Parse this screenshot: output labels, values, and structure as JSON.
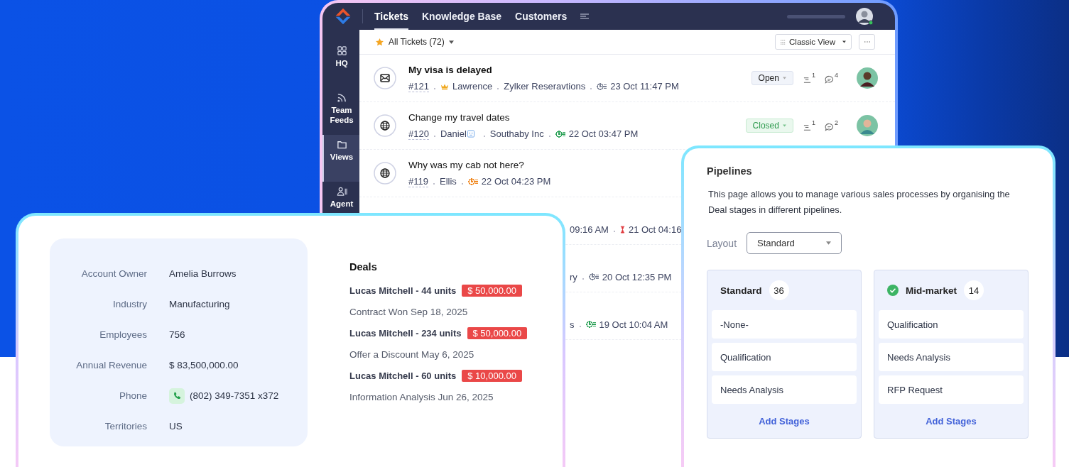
{
  "tickets_window": {
    "nav_tabs": [
      {
        "label": "Tickets",
        "selected": true
      },
      {
        "label": "Knowledge Base",
        "selected": false
      },
      {
        "label": "Customers",
        "selected": false
      }
    ],
    "sidebar": [
      {
        "label": "HQ",
        "selected": false
      },
      {
        "label": "Team Feeds",
        "selected": false
      },
      {
        "label": "Views",
        "selected": true
      },
      {
        "label": "Agent",
        "selected": false
      }
    ],
    "view_filter": "All Tickets (72)",
    "view_mode": "Classic View",
    "tickets": [
      {
        "kind": "email",
        "title": "My visa is delayed",
        "unread": true,
        "meta": [
          {
            "kind": "id",
            "text": "#121"
          },
          {
            "kind": "vip-contact",
            "text": "Lawrence"
          },
          {
            "kind": "account",
            "text": "Zylker Reseravtions"
          },
          {
            "kind": "due",
            "text": "23 Oct 11:47 PM",
            "color": "#7a8194"
          }
        ],
        "status": {
          "label": "Open",
          "kind": "open"
        },
        "tasks": "1",
        "comments": "4"
      },
      {
        "kind": "web",
        "title": "Change my travel dates",
        "unread": false,
        "meta": [
          {
            "kind": "id",
            "text": "#120"
          },
          {
            "kind": "card-contact",
            "text": "Daniel"
          },
          {
            "kind": "account",
            "text": "Southaby Inc"
          },
          {
            "kind": "due",
            "text": "22 Oct 03:47 PM",
            "color": "#2fa35a"
          }
        ],
        "status": {
          "label": "Closed",
          "kind": "closed"
        },
        "tasks": "1",
        "comments": "2"
      },
      {
        "kind": "web",
        "title": "Why was my cab not here?",
        "unread": false,
        "meta": [
          {
            "kind": "id",
            "text": "#119"
          },
          {
            "kind": "contact",
            "text": "Ellis"
          },
          {
            "kind": "due",
            "text": "22 Oct 04:23 PM",
            "color": "#f08a24"
          }
        ]
      },
      {
        "kind": "partial",
        "meta": [
          {
            "kind": "time",
            "text": "09:16 AM"
          },
          {
            "kind": "overdue",
            "text": "21 Oct 04:16"
          }
        ]
      },
      {
        "kind": "partial",
        "meta": [
          {
            "kind": "account",
            "text": "ry"
          },
          {
            "kind": "due",
            "text": "20 Oct 12:35 PM",
            "color": "#7a8194"
          }
        ]
      },
      {
        "kind": "partial",
        "meta": [
          {
            "kind": "account",
            "text": "s"
          },
          {
            "kind": "due",
            "text": "19 Oct 10:04 AM",
            "color": "#2fa35a"
          }
        ]
      }
    ]
  },
  "account_card": {
    "fields": [
      {
        "label": "Account Owner",
        "value": "Amelia Burrows"
      },
      {
        "label": "Industry",
        "value": "Manufacturing"
      },
      {
        "label": "Employees",
        "value": "756"
      },
      {
        "label": "Annual Revenue",
        "value": "$ 83,500,000.00"
      },
      {
        "label": "Phone",
        "value": "(802) 349-7351 x372",
        "kind": "phone"
      },
      {
        "label": "Territories",
        "value": "US"
      }
    ],
    "deals_title": "Deals",
    "deals": [
      {
        "name": "Lucas Mitchell - 44 units",
        "amount": "$ 50,000.00",
        "stage": "Contract Won Sep 18, 2025"
      },
      {
        "name": "Lucas Mitchell - 234 units",
        "amount": "$ 50,000.00",
        "stage": "Offer a Discount May 6, 2025"
      },
      {
        "name": "Lucas Mitchell - 60 units",
        "amount": "$ 10,000.00",
        "stage": "Information Analysis Jun 26, 2025"
      }
    ]
  },
  "pipelines_card": {
    "title": "Pipelines",
    "description": "This page allows you to manage various sales processes by organising the Deal stages in different pipelines.",
    "layout_label": "Layout",
    "layout_value": "Standard",
    "pipelines": [
      {
        "name": "Standard",
        "count": "36",
        "default": false,
        "stages": [
          "-None-",
          "Qualification",
          "Needs Analysis"
        ],
        "action": "Add Stages"
      },
      {
        "name": "Mid-market",
        "count": "14",
        "default": true,
        "stages": [
          "Qualification",
          "Needs Analysis",
          "RFP Request"
        ],
        "action": "Add Stages"
      }
    ]
  }
}
